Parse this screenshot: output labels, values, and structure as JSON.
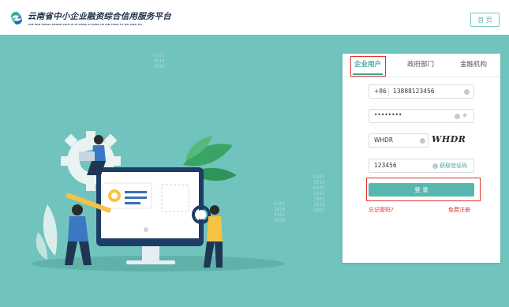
{
  "header": {
    "logo_title": "云南省中小企业融资综合信用服务平台",
    "logo_pinyin": "YUN NAN SHENG ZHONG XIAO QI YE RONG ZI ZONG HE XIN YONG FU WU PING TAI",
    "home_button": "首 页"
  },
  "login": {
    "tabs": [
      {
        "label": "企业用户",
        "active": true
      },
      {
        "label": "政府部门",
        "active": false
      },
      {
        "label": "金融机构",
        "active": false
      }
    ],
    "phone": {
      "prefix": "+86",
      "value": "13888123456"
    },
    "password": {
      "value": "••••••••"
    },
    "captcha": {
      "value": "WHDR",
      "image_text": "WHDR"
    },
    "sms": {
      "value": "123456",
      "button": "获取验证码"
    },
    "submit_label": "登 录",
    "forgot_label": "忘记密码?",
    "register_label": "免费注册"
  },
  "hero": {
    "binary_left": [
      "0101",
      "1010",
      "1010"
    ],
    "binary_mid": [
      "0101",
      "1010",
      "0101",
      "1010"
    ],
    "binary_right": [
      "0101",
      "1010",
      "0101",
      "1010",
      "1001",
      "1010",
      "1001"
    ]
  },
  "colors": {
    "brand": "#3aa79e",
    "hero_bg": "#71c3bd",
    "highlight": "#e0322d"
  }
}
